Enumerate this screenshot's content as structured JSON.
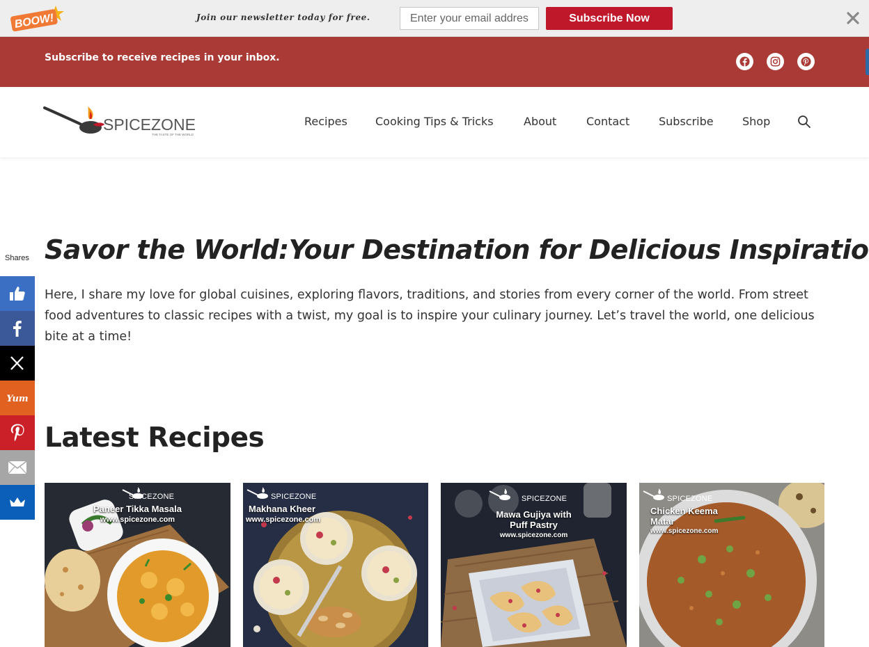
{
  "topbar": {
    "badge": "BOOW!",
    "newsletter_text": "Join our newsletter today for free.",
    "email_placeholder": "Enter your email address",
    "subscribe_label": "Subscribe Now",
    "close_icon": "close-icon",
    "colors": {
      "button": "#c0182b",
      "background": "#eeeeee"
    }
  },
  "redbar": {
    "text": "Subscribe to receive recipes in your inbox.",
    "social": [
      "facebook-icon",
      "instagram-icon",
      "pinterest-icon"
    ],
    "color": "#a93a35"
  },
  "header": {
    "logo": {
      "name": "SPICEZONE",
      "tagline": "THE TASTE OF THE WORLD"
    },
    "nav": [
      "Recipes",
      "Cooking Tips & Tricks",
      "About",
      "Contact",
      "Subscribe",
      "Shop"
    ],
    "search_icon": "search-icon"
  },
  "share_bar": {
    "label": "Shares",
    "buttons": [
      {
        "name": "like-icon",
        "color": "#3b6fc4"
      },
      {
        "name": "facebook-icon",
        "color": "#3b5998"
      },
      {
        "name": "x-icon",
        "color": "#000000"
      },
      {
        "name": "yummly-icon",
        "color": "#e16120"
      },
      {
        "name": "pinterest-icon",
        "color": "#cb2027"
      },
      {
        "name": "email-icon",
        "color": "#a6a6a6"
      },
      {
        "name": "sumo-crown-icon",
        "color": "#0b5fb8"
      }
    ],
    "yum_text": "Yum"
  },
  "hero": {
    "title": "Savor the World:Your Destination for Delicious Inspiration",
    "text": "Here, I share my love for global cuisines, exploring flavors, traditions, and stories from every corner of the world. From street food adventures to classic recipes with a twist, my goal is to inspire your culinary journey. Let’s travel the world, one delicious bite at a time!"
  },
  "latest": {
    "title": "Latest Recipes",
    "cards": [
      {
        "brand": "SPICEZONE",
        "title": "Paneer Tikka Masala",
        "url": "www.spicezone.com"
      },
      {
        "brand": "SPICEZONE",
        "title": "Makhana Kheer",
        "url": "www.spicezone.com"
      },
      {
        "brand": "SPICEZONE",
        "title": "Mawa Gujiya with Puff Pastry",
        "url": "www.spicezone.com"
      },
      {
        "brand": "SPICEZONE",
        "title": "Chicken Keema Matar",
        "url": "www.spicezone.com"
      }
    ]
  }
}
